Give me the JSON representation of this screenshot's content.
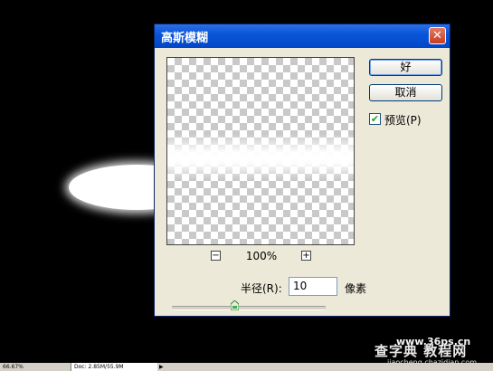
{
  "dialog": {
    "title": "高斯模糊",
    "close_label": "✕",
    "ok_label": "好",
    "cancel_label": "取消",
    "preview_label": "预览(P)",
    "preview_checked": true,
    "check_mark": "✔",
    "zoom_out_label": "−",
    "zoom_in_label": "+",
    "zoom_level": "100%",
    "radius_label": "半径(R):",
    "radius_value": "10",
    "radius_unit": "像素"
  },
  "status_bar": {
    "zoom": "66.67%",
    "doc": "Doc: 2.85M/55.9M",
    "arrow": "▶"
  },
  "watermark": {
    "url": "www.36ps.cn",
    "logo": "查字典 教程网",
    "sub": "jiaocheng.chazidian.com"
  }
}
